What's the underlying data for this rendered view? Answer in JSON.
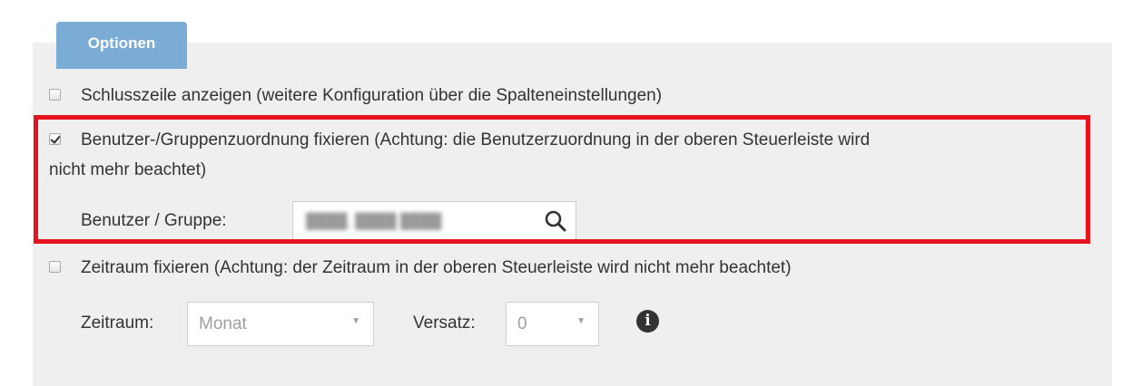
{
  "tab": {
    "label": "Optionen"
  },
  "options": {
    "summary_row": {
      "checked": false,
      "label": "Schlusszeile anzeigen (weitere Konfiguration über die Spalteneinstellungen)"
    },
    "fix_user": {
      "checked": true,
      "label_line1": "Benutzer-/Gruppenzuordnung fixieren (Achtung: die Benutzerzuordnung in der oberen Steuerleiste wird",
      "label_line2": "nicht mehr beachtet)",
      "field_label": "Benutzer / Gruppe:",
      "field_value": "████, ████ ████"
    },
    "fix_period": {
      "checked": false,
      "label": "Zeitraum fixieren (Achtung: der Zeitraum in der oberen Steuerleiste wird nicht mehr beachtet)",
      "period_label": "Zeitraum:",
      "period_value": "Monat",
      "offset_label": "Versatz:",
      "offset_value": "0"
    }
  },
  "icons": {
    "search": "search-icon",
    "info": "info-icon",
    "dropdown": "caret-down-icon"
  },
  "colors": {
    "tab_bg": "#7bacd6",
    "panel_bg": "#efefef",
    "highlight_border": "#e4141e"
  }
}
